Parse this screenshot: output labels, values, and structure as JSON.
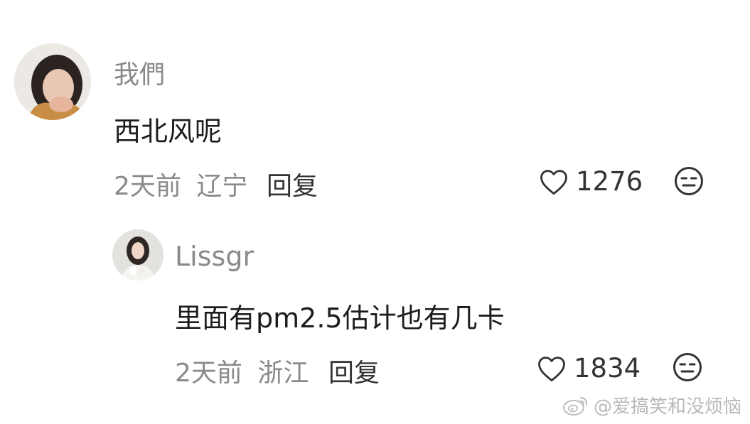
{
  "comments": [
    {
      "username": "我們",
      "text": "西北风呢",
      "time": "2天前",
      "location": "辽宁",
      "reply_label": "回复",
      "likes": "1276"
    }
  ],
  "replies": [
    {
      "username": "Lissgr",
      "text": "里面有pm2.5估计也有几卡",
      "time": "2天前",
      "location": "浙江",
      "reply_label": "回复",
      "likes": "1834"
    }
  ],
  "watermark": {
    "text": "@爱搞笑和没烦恼",
    "icon": "weibo-icon"
  },
  "icons": {
    "like": "heart-outline-icon",
    "dislike": "meh-face-icon"
  },
  "colors": {
    "muted_text": "#8a8a8a",
    "body_text": "#1c1c1c",
    "background": "#ffffff"
  }
}
